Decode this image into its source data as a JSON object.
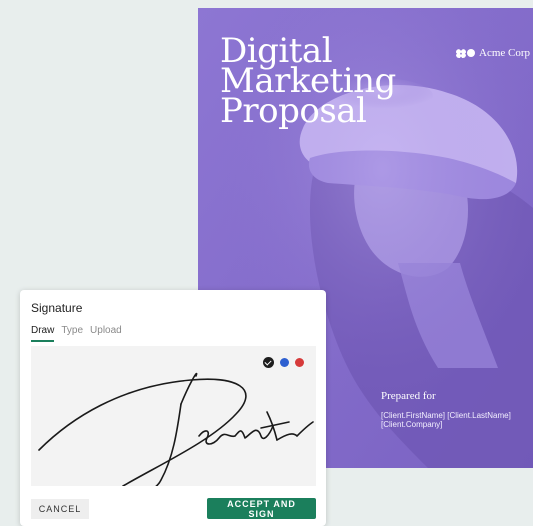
{
  "proposal": {
    "title_lines": [
      "Digital",
      "Marketing",
      "Proposal"
    ],
    "brand_name": "Acme Corp",
    "prepared_label": "Prepared for",
    "client_name": "[Client.FirstName] [Client.LastName]",
    "client_company": "[Client.Company]",
    "background_color": "#8a72cf"
  },
  "dialog": {
    "title": "Signature",
    "tabs": [
      {
        "label": "Draw",
        "active": true
      },
      {
        "label": "Type",
        "active": false
      },
      {
        "label": "Upload",
        "active": false
      }
    ],
    "pen_colors": [
      {
        "name": "black",
        "hex": "#1d1d1d",
        "selected": true
      },
      {
        "name": "blue",
        "hex": "#2d5fd0",
        "selected": false
      },
      {
        "name": "red",
        "hex": "#d63a3a",
        "selected": false
      }
    ],
    "cancel_label": "CANCEL",
    "accept_label": "ACCEPT AND SIGN",
    "accent_color": "#1b7f5c"
  }
}
